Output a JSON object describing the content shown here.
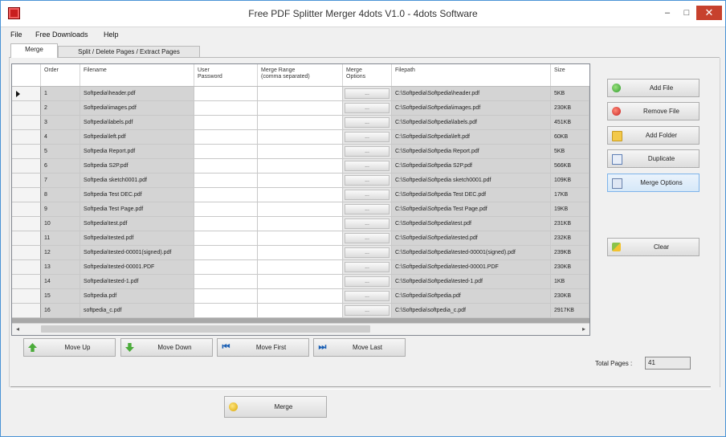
{
  "window": {
    "title": "Free PDF Splitter Merger 4dots V1.0 - 4dots Software",
    "minimize": "‒",
    "maximize": "□",
    "close": "✕"
  },
  "menu": [
    "File",
    "Free Downloads",
    "Help"
  ],
  "tabs": [
    "Merge",
    "Split / Delete Pages / Extract Pages"
  ],
  "grid": {
    "columns": {
      "order": "Order",
      "filename": "Filename",
      "user_password_1": "User",
      "user_password_2": "Password",
      "merge_range_1": "Merge Range",
      "merge_range_2": "(comma separated)",
      "merge_options_1": "Merge",
      "merge_options_2": "Options",
      "filepath": "Filepath",
      "size": "Size"
    },
    "option_button": "...",
    "rows": [
      {
        "order": "1",
        "filename": "Softpedia\\header.pdf",
        "filepath": "C:\\Softpedia\\Softpedia\\header.pdf",
        "size": "5KB"
      },
      {
        "order": "2",
        "filename": "Softpedia\\images.pdf",
        "filepath": "C:\\Softpedia\\Softpedia\\images.pdf",
        "size": "230KB"
      },
      {
        "order": "3",
        "filename": "Softpedia\\labels.pdf",
        "filepath": "C:\\Softpedia\\Softpedia\\labels.pdf",
        "size": "451KB"
      },
      {
        "order": "4",
        "filename": "Softpedia\\left.pdf",
        "filepath": "C:\\Softpedia\\Softpedia\\left.pdf",
        "size": "60KB"
      },
      {
        "order": "5",
        "filename": "Softpedia Report.pdf",
        "filepath": "C:\\Softpedia\\Softpedia Report.pdf",
        "size": "5KB"
      },
      {
        "order": "6",
        "filename": "Softpedia S2P.pdf",
        "filepath": "C:\\Softpedia\\Softpedia S2P.pdf",
        "size": "566KB"
      },
      {
        "order": "7",
        "filename": "Softpedia sketch0001.pdf",
        "filepath": "C:\\Softpedia\\Softpedia sketch0001.pdf",
        "size": "109KB"
      },
      {
        "order": "8",
        "filename": "Softpedia Test DEC.pdf",
        "filepath": "C:\\Softpedia\\Softpedia Test DEC.pdf",
        "size": "17KB"
      },
      {
        "order": "9",
        "filename": "Softpedia Test Page.pdf",
        "filepath": "C:\\Softpedia\\Softpedia Test Page.pdf",
        "size": "19KB"
      },
      {
        "order": "10",
        "filename": "Softpedia\\test.pdf",
        "filepath": "C:\\Softpedia\\Softpedia\\test.pdf",
        "size": "231KB"
      },
      {
        "order": "11",
        "filename": "Softpedia\\tested.pdf",
        "filepath": "C:\\Softpedia\\Softpedia\\tested.pdf",
        "size": "232KB"
      },
      {
        "order": "12",
        "filename": "Softpedia\\tested-00001(signed).pdf",
        "filepath": "C:\\Softpedia\\Softpedia\\tested-00001(signed).pdf",
        "size": "239KB"
      },
      {
        "order": "13",
        "filename": "Softpedia\\tested-00001.PDF",
        "filepath": "C:\\Softpedia\\Softpedia\\tested-00001.PDF",
        "size": "230KB"
      },
      {
        "order": "14",
        "filename": "Softpedia\\tested-1.pdf",
        "filepath": "C:\\Softpedia\\Softpedia\\tested-1.pdf",
        "size": "1KB"
      },
      {
        "order": "15",
        "filename": "Softpedia.pdf",
        "filepath": "C:\\Softpedia\\Softpedia.pdf",
        "size": "230KB"
      },
      {
        "order": "16",
        "filename": "softpedia_c.pdf",
        "filepath": "C:\\Softpedia\\softpedia_c.pdf",
        "size": "2917KB"
      }
    ]
  },
  "side_buttons": {
    "add_file": "Add File",
    "remove_file": "Remove File",
    "add_folder": "Add Folder",
    "duplicate": "Duplicate",
    "merge_options": "Merge Options",
    "clear": "Clear"
  },
  "move_buttons": {
    "up": "Move Up",
    "down": "Move Down",
    "first": "Move First",
    "last": "Move Last"
  },
  "total_pages": {
    "label": "Total Pages :",
    "value": "41"
  },
  "merge_button": "Merge"
}
